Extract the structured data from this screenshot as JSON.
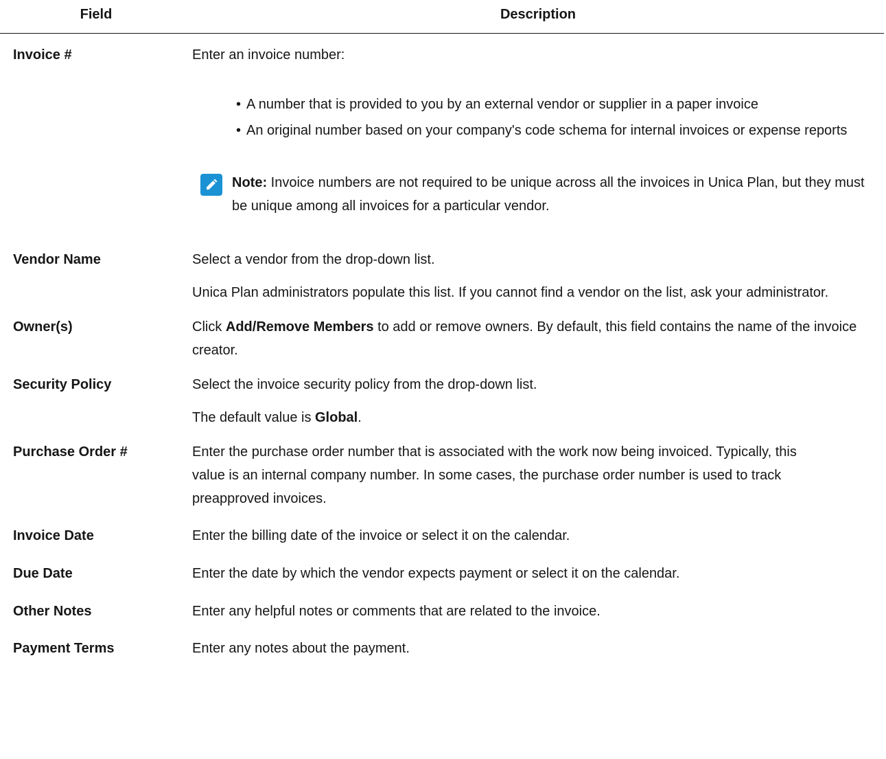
{
  "header": {
    "field": "Field",
    "description": "Description"
  },
  "rows": {
    "invoice_number": {
      "field": "Invoice #",
      "intro": "Enter an invoice number:",
      "bullets": [
        "A number that is provided to you by an external vendor or supplier in a paper invoice",
        "An original number based on your company's code schema for internal invoices or expense reports"
      ],
      "note_label": "Note:",
      "note_text": " Invoice numbers are not required to be unique across all the invoices in Unica Plan, but they must be unique among all invoices for a particular vendor.",
      "note_icon": "pencil-icon",
      "note_icon_color": "#1a92d4"
    },
    "vendor_name": {
      "field": "Vendor Name",
      "line1": "Select a vendor from the drop-down list.",
      "line2": "Unica Plan administrators populate this list. If you cannot find a vendor on the list, ask your administrator."
    },
    "owners": {
      "field": "Owner(s)",
      "pre": "Click ",
      "bold": "Add/Remove Members",
      "post": " to add or remove owners. By default, this field contains the name of the invoice creator."
    },
    "security_policy": {
      "field": "Security Policy",
      "line1": "Select the invoice security policy from the drop-down list.",
      "line2_pre": "The default value is ",
      "line2_bold": "Global",
      "line2_post": "."
    },
    "purchase_order": {
      "field": "Purchase Order #",
      "text": "Enter the purchase order number that is associated with the work now being invoiced. Typically, this value is an internal company number. In some cases, the purchase order number is used to track preapproved invoices."
    },
    "invoice_date": {
      "field": "Invoice Date",
      "text": "Enter the billing date of the invoice or select it on the calendar."
    },
    "due_date": {
      "field": "Due Date",
      "text": "Enter the date by which the vendor expects payment or select it on the calendar."
    },
    "other_notes": {
      "field": "Other Notes",
      "text": "Enter any helpful notes or comments that are related to the invoice."
    },
    "payment_terms": {
      "field": "Payment Terms",
      "text": "Enter any notes about the payment."
    }
  }
}
